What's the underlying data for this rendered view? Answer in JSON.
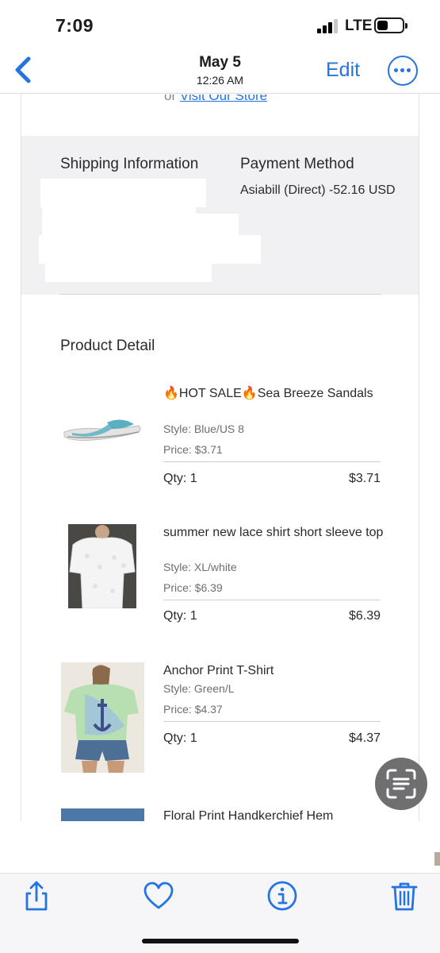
{
  "status_bar": {
    "time": "7:09",
    "network": "LTE",
    "signal_bars_on": 3,
    "battery_level": 0.3
  },
  "nav": {
    "date": "May 5",
    "time": "12:26 AM",
    "edit_label": "Edit",
    "back_icon": "chevron-left-icon",
    "more_icon": "ellipsis-circle-icon"
  },
  "email": {
    "visit_prefix": "or",
    "visit_link": "Visit Our Store",
    "shipping_title": "Shipping Information",
    "payment_title": "Payment Method",
    "payment_value": "Asiabill (Direct)  -52.16 USD",
    "product_section_title": "Product Detail",
    "products": [
      {
        "name": "🔥HOT SALE🔥Sea Breeze Sandals",
        "style": "Style: Blue/US 8",
        "price": "Price: $3.71",
        "qty": "Qty: 1",
        "total": "$3.71"
      },
      {
        "name": "summer new lace shirt short sleeve top",
        "style": "Style: XL/white",
        "price": "Price: $6.39",
        "qty": "Qty: 1",
        "total": "$6.39"
      },
      {
        "name": "Anchor Print T-Shirt",
        "style": "Style: Green/L",
        "price": "Price: $4.37",
        "qty": "Qty: 1",
        "total": "$4.37"
      },
      {
        "name": "Floral Print Handkerchief Hem"
      }
    ]
  },
  "toolbar": {
    "icons": [
      "share-icon",
      "heart-icon",
      "info-icon",
      "trash-icon"
    ]
  },
  "colors": {
    "accent": "#2474e5",
    "band": "#f1f1f3",
    "scan_button": "#6f6f71"
  }
}
